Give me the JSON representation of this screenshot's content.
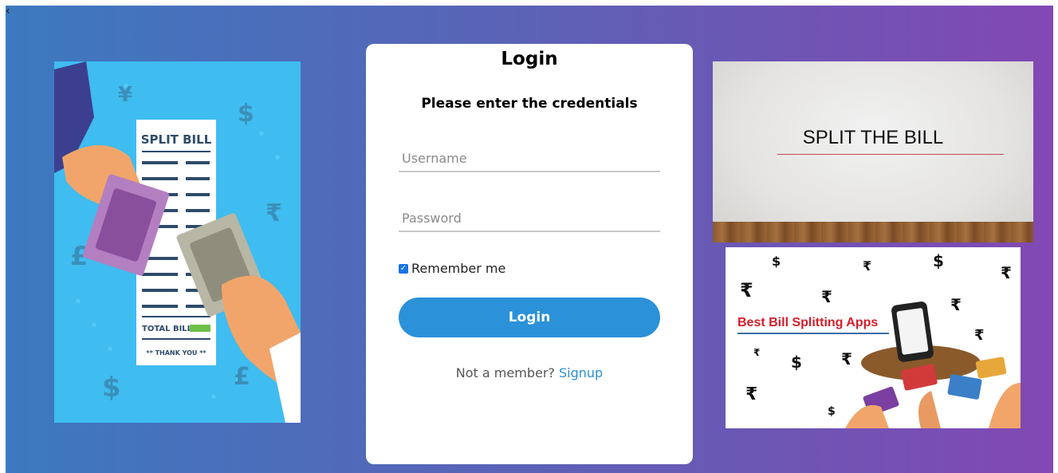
{
  "nav": {
    "back_glyph": "‹"
  },
  "left_image": {
    "heading": "SPLIT BILL",
    "total": "TOTAL BILL",
    "thanks": "** THANK YOU **"
  },
  "login": {
    "title": "Login",
    "subtitle": "Please enter the credentials",
    "username": {
      "value": "",
      "placeholder": "Username"
    },
    "password": {
      "value": "",
      "placeholder": "Password"
    },
    "remember_label": "Remember me",
    "remember_checked": true,
    "submit_label": "Login",
    "signup_prompt": "Not a member?",
    "signup_link": "Signup"
  },
  "right_top_image": {
    "title": "SPLIT THE BILL"
  },
  "right_bottom_image": {
    "caption": "Best Bill Splitting Apps"
  },
  "colors": {
    "accent": "#2b91d8",
    "link": "#2b8fd4",
    "gradient_start": "#3c79bf",
    "gradient_end": "#8248b3"
  }
}
